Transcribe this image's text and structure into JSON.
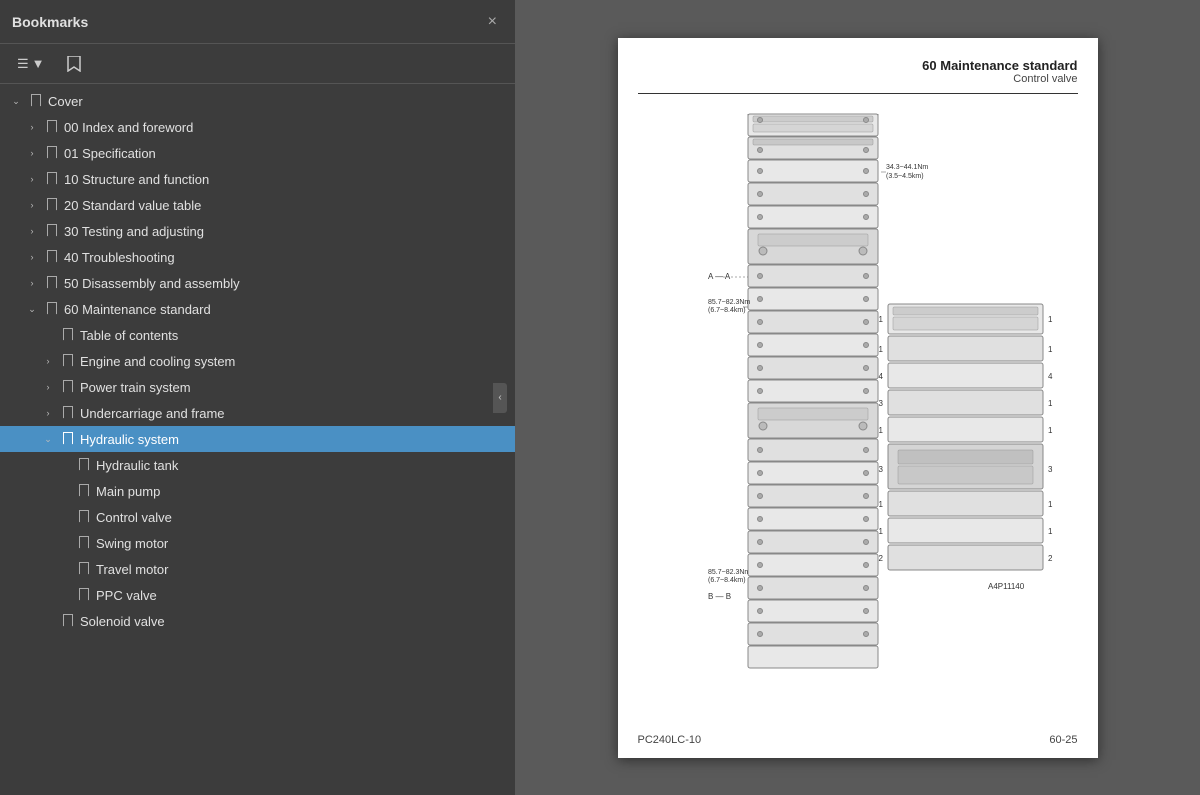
{
  "panel": {
    "title": "Bookmarks",
    "close_label": "×",
    "toolbar": {
      "view_btn_label": "≡ ▾",
      "bookmark_btn_label": "🔖"
    }
  },
  "tree": {
    "items": [
      {
        "id": "cover",
        "level": 0,
        "label": "Cover",
        "expanded": true,
        "selected": false,
        "has_children": true
      },
      {
        "id": "00-index",
        "level": 1,
        "label": "00 Index and foreword",
        "expanded": false,
        "selected": false,
        "has_children": true
      },
      {
        "id": "01-spec",
        "level": 1,
        "label": "01 Specification",
        "expanded": false,
        "selected": false,
        "has_children": true
      },
      {
        "id": "10-struct",
        "level": 1,
        "label": "10 Structure and function",
        "expanded": false,
        "selected": false,
        "has_children": true
      },
      {
        "id": "20-std",
        "level": 1,
        "label": "20 Standard value table",
        "expanded": false,
        "selected": false,
        "has_children": true
      },
      {
        "id": "30-test",
        "level": 1,
        "label": "30 Testing and adjusting",
        "expanded": false,
        "selected": false,
        "has_children": true
      },
      {
        "id": "40-trouble",
        "level": 1,
        "label": "40 Troubleshooting",
        "expanded": false,
        "selected": false,
        "has_children": true
      },
      {
        "id": "50-disasm",
        "level": 1,
        "label": "50 Disassembly and assembly",
        "expanded": false,
        "selected": false,
        "has_children": true
      },
      {
        "id": "60-maint",
        "level": 1,
        "label": "60 Maintenance standard",
        "expanded": true,
        "selected": false,
        "has_children": true
      },
      {
        "id": "toc",
        "level": 2,
        "label": "Table of contents",
        "expanded": false,
        "selected": false,
        "has_children": false
      },
      {
        "id": "engine",
        "level": 2,
        "label": "Engine and cooling system",
        "expanded": false,
        "selected": false,
        "has_children": true
      },
      {
        "id": "powertrain",
        "level": 2,
        "label": "Power train system",
        "expanded": false,
        "selected": false,
        "has_children": true
      },
      {
        "id": "undercarriage",
        "level": 2,
        "label": "Undercarriage and frame",
        "expanded": false,
        "selected": false,
        "has_children": true
      },
      {
        "id": "hydraulic",
        "level": 2,
        "label": "Hydraulic system",
        "expanded": true,
        "selected": true,
        "has_children": true
      },
      {
        "id": "hydraulic-tank",
        "level": 3,
        "label": "Hydraulic tank",
        "expanded": false,
        "selected": false,
        "has_children": false
      },
      {
        "id": "main-pump",
        "level": 3,
        "label": "Main pump",
        "expanded": false,
        "selected": false,
        "has_children": false
      },
      {
        "id": "control-valve",
        "level": 3,
        "label": "Control valve",
        "expanded": false,
        "selected": false,
        "has_children": false
      },
      {
        "id": "swing-motor",
        "level": 3,
        "label": "Swing motor",
        "expanded": false,
        "selected": false,
        "has_children": false
      },
      {
        "id": "travel-motor",
        "level": 3,
        "label": "Travel motor",
        "expanded": false,
        "selected": false,
        "has_children": false
      },
      {
        "id": "ppc-valve",
        "level": 3,
        "label": "PPC valve",
        "expanded": false,
        "selected": false,
        "has_children": false
      },
      {
        "id": "solenoid",
        "level": 2,
        "label": "Solenoid valve",
        "expanded": false,
        "selected": false,
        "has_children": false
      }
    ]
  },
  "document": {
    "header_main": "60 Maintenance standard",
    "header_sub": "Control valve",
    "footer_left": "PC240LC-10",
    "footer_right": "60-25",
    "diagram_label_aa": "A — A",
    "diagram_label_bb": "B — B",
    "diagram_torque1": "34.3~44.1Nm\n(3.5~4.5km)",
    "diagram_torque2": "85.7~82.3Nm\n(6.7~8.4km)",
    "diagram_torque3": "85.7~82.3Nm\n(6.7~8.4km)",
    "diagram_ref": "A4P11140"
  }
}
